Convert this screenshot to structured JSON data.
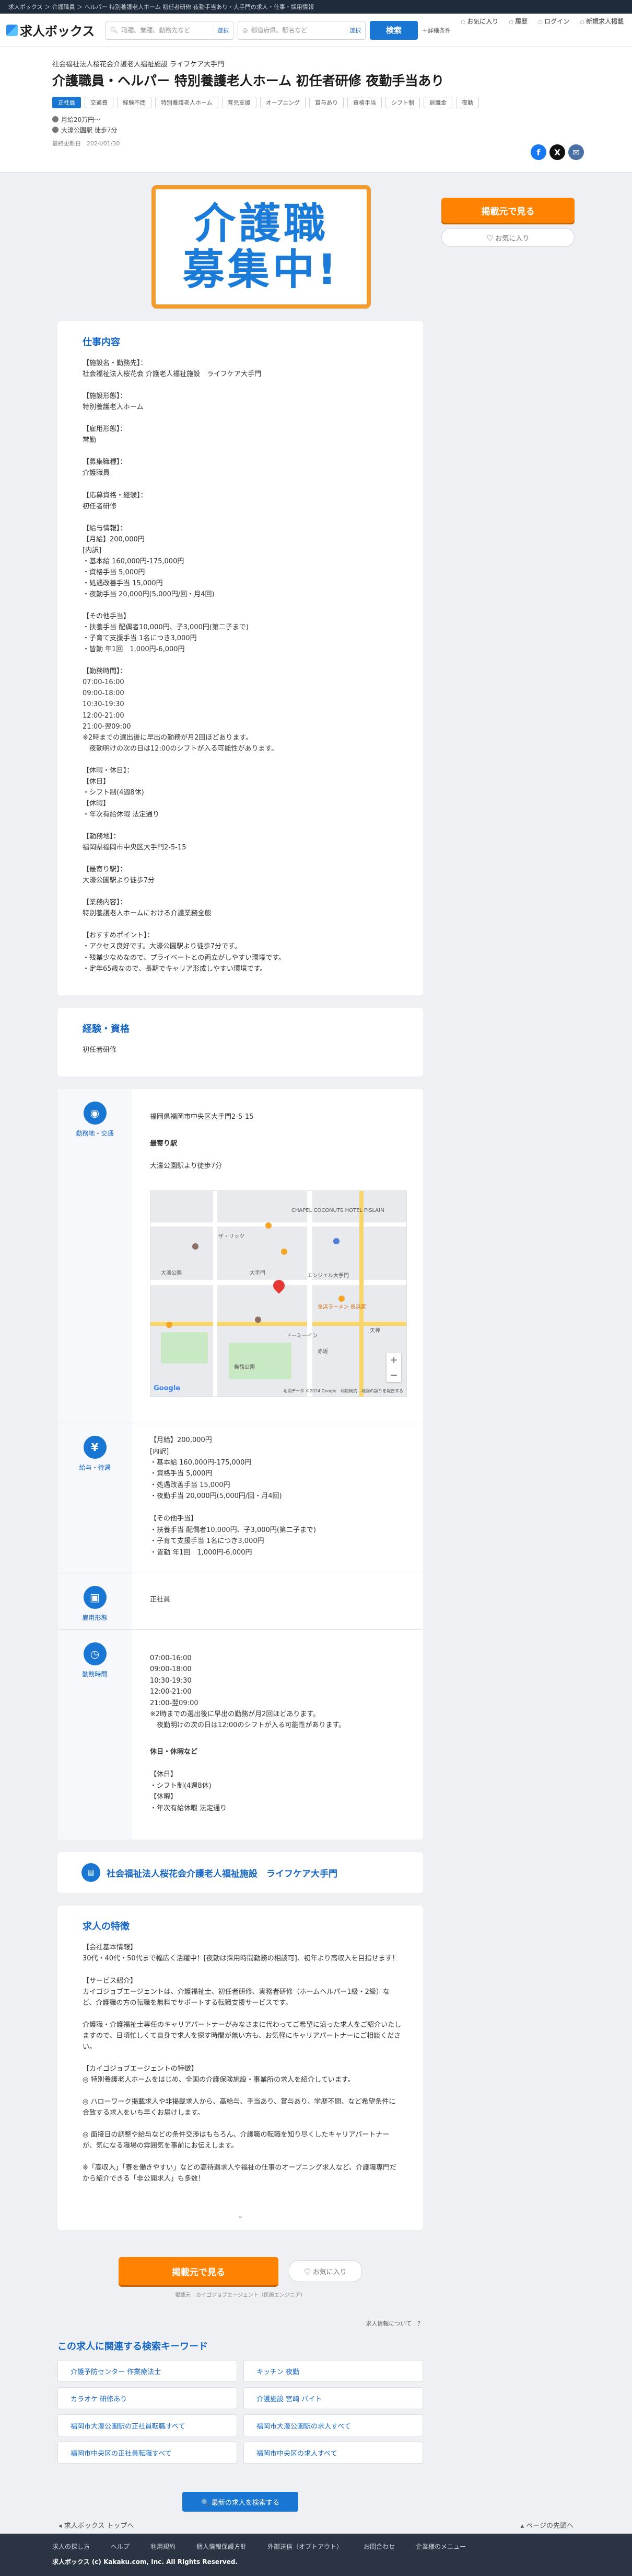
{
  "topbar": {
    "breadcrumb": "求人ボックス ＞ 介護職員 ＞ ヘルパー 特別養護老人ホーム 初任者研修 夜勤手当あり・大手門の求人・仕事・採用情報"
  },
  "header": {
    "logo_text": "求人ボックス",
    "job_placeholder": "職種、業種、勤務先など",
    "job_select": "選択",
    "area_placeholder": "都道府県、駅名など",
    "area_select": "選択",
    "search_label": "検索",
    "detail_label": "＋詳細条件",
    "fav_label": "お気に入り",
    "history_label": "履歴",
    "login_label": "ログイン",
    "post_label": "新規求人掲載"
  },
  "job": {
    "company": "社会福祉法人桜花会介護老人福祉施設 ライフケア大手門",
    "title": "介護職員・ヘルパー 特別養護老人ホーム 初任者研修 夜勤手当あり",
    "tags": [
      "正社員",
      "交通費",
      "経験不問",
      "特別養護老人ホーム",
      "育児支援",
      "オープニング",
      "賞与あり",
      "資格手当",
      "シフト制",
      "退職金",
      "夜勤"
    ],
    "salary_meta": "月給20万円～",
    "access_meta": "大濠公園駅 徒歩7分",
    "posted": "最終更新日　2024/01/30"
  },
  "banner": {
    "line1": "介護職",
    "line2": "募集中!"
  },
  "side": {
    "apply_label": "掲載元で見る",
    "fav_label": "♡ お気に入り"
  },
  "share": {
    "facebook": "f",
    "x": "X",
    "mail": "✉"
  },
  "work": {
    "heading": "仕事内容",
    "body": "【施設名・勤務先】：\n社会福祉法人桜花会 介護老人福祉施設　ライフケア大手門\n\n【施設形態】：\n特別養護老人ホーム\n\n【雇用形態】：\n常勤\n\n【募集職種】：\n介護職員\n\n【応募資格・経験】：\n初任者研修\n\n【給与情報】：\n【月給】200,000円\n[内訳]\n・基本給 160,000円-175,000円\n・資格手当 5,000円\n・処遇改善手当 15,000円\n・夜勤手当 20,000円(5,000円/回・月4回)\n\n【その他手当】\n・扶養手当 配偶者10,000円、子3,000円(第二子まで)\n・子育て支援手当 1名につき3,000円\n・皆勤 年1回　1,000円-6,000円\n\n【勤務時間】：\n07:00-16:00\n09:00-18:00\n10:30-19:30\n12:00-21:00\n21:00-翌09:00\n※2時までの選出後に早出の勤務が月2回ほどあります。\n　夜勤明けの次の日は12:00のシフトが入る可能性があります。\n\n【休暇・休日】：\n【休日】\n・シフト制(4週8休)\n【休暇】\n・年次有給休暇 法定通り\n\n【勤務地】：\n福岡県福岡市中央区大手門2-5-15\n\n【最寄り駅】：\n大濠公園駅より徒歩7分\n\n【業務内容】：\n特別養護老人ホームにおける介護業務全般\n\n【おすすめポイント】：\n・アクセス良好です。大濠公園駅より徒歩7分です。\n・残業少なめなので、プライベートとの両立がしやすい環境です。\n・定年65歳なので、長期でキャリア形成しやすい環境です。"
  },
  "qualify": {
    "heading": "経験・資格",
    "body": "初任者研修"
  },
  "info": {
    "access": {
      "label": "勤務地・交通",
      "address": "福岡県福岡市中央区大手門2-5-15",
      "station_head": "最寄り駅",
      "station": "大濠公園駅より徒歩7分"
    },
    "salary": {
      "label": "給与・待遇",
      "body": "【月給】200,000円\n[内訳]\n・基本給 160,000円-175,000円\n・資格手当 5,000円\n・処遇改善手当 15,000円\n・夜勤手当 20,000円(5,000円/回・月4回)\n\n【その他手当】\n・扶養手当 配偶者10,000円、子3,000円(第二子まで)\n・子育て支援手当 1名につき3,000円\n・皆勤 年1回　1,000円-6,000円"
    },
    "employment": {
      "label": "雇用形態",
      "body": "正社員"
    },
    "hours": {
      "label": "勤務時間",
      "body": "07:00-16:00\n09:00-18:00\n10:30-19:30\n12:00-21:00\n21:00-翌09:00\n※2時までの選出後に早出の勤務が月2回ほどあります。\n　夜勤明けの次の日は12:00のシフトが入る可能性があります。",
      "holiday_head": "休日・休暇など",
      "holiday_body": "【休日】\n・シフト制(4週8休)\n【休暇】\n・年次有給休暇 法定通り"
    }
  },
  "map": {
    "labels": [
      "CHAPEL COCONUTS HOTEL PISLAIN",
      "ザ・リッツ",
      "大濠公園",
      "舞鶴公園",
      "赤坂",
      "大手門",
      "天神",
      "エンジェル大手門",
      "長浜ラーメン 長浜家",
      "ドーミーイン"
    ],
    "google": "Google",
    "attribution": "地図データ ©2024 Google　利用規約　地図の誤りを報告する"
  },
  "company": {
    "name": "社会福祉法人桜花会介護老人福祉施設　ライフケア大手門"
  },
  "feature": {
    "heading": "求人の特徴",
    "body": "【会社基本情報】\n30代・40代・50代まで幅広く活躍中！[夜勤は採用時間勤務の相談可]、初年より高収入を目指せます！\n\n【サービス紹介】\nカイゴジョブエージェントは、介護福祉士、初任者研修、実務者研修（ホームヘルパー1級・2級）など、介護職の方の転職を無料でサポートする転職支援サービスです。\n\n介護職・介護福祉士専任のキャリアパートナーがみなさまに代わってご希望に沿った求人をご紹介いたしますので、日頃忙しくて自身で求人を探す時間が無い方も、お気軽にキャリアパートナーにご相談ください。\n\n【カイゴジョブエージェントの特徴】\n◎ 特別養護老人ホームをはじめ、全国の介護保険施設・事業所の求人を紹介しています。\n\n◎ ハローワーク掲載求人や非掲載求人から、高給与、手当あり、賞与あり、学歴不問、など希望条件に合致する求人をいち早くお届けします。\n\n◎ 面接日の調整や給与などの条件交渉はもちろん、介護職の転職を知り尽くしたキャリアパートナーが、気になる職場の雰囲気を事前にお伝えします。\n\n※「高収入」「寮を働きやすい」などの高待遇求人や福祉の仕事のオープニング求人など、介護職専門だから紹介できる「非公開求人」も多数！"
  },
  "bottom": {
    "apply_label": "掲載元で見る",
    "fav_label": "♡ お気に入り",
    "note": "掲載元　カイゴジョブエージェント（医療エンジニア）",
    "report": "求人情報について　？"
  },
  "related": {
    "heading": "この求人に関連する検索キーワード",
    "keywords": [
      "介護予防センター 作業療法士",
      "キッチン 夜勤",
      "カラオケ 研修あり",
      "介護施設 宮崎 バイト",
      "福岡市大濠公園駅の正社員転職すべて",
      "福岡市大濠公園駅の求人すべて",
      "福岡市中央区の正社員転職すべて",
      "福岡市中央区の求人すべて"
    ],
    "newest_label": "🔍 最新の求人を検索する"
  },
  "pager": {
    "prev": "◂ 求人ボックス トップへ",
    "next": "▴ ページの先頭へ"
  },
  "footer": {
    "links": [
      "求人の探し方",
      "ヘルプ",
      "利用規約",
      "個人情報保護方針",
      "外部送信（オプトアウト）",
      "お問合わせ",
      "企業様のメニュー"
    ],
    "copyright": "求人ボックス (c) Kakaku.com, Inc. All Rights Reserved."
  },
  "colors": {
    "brand_blue": "#1976d2",
    "apply_orange": "#ff8200",
    "banner_border": "#f29b2e"
  }
}
